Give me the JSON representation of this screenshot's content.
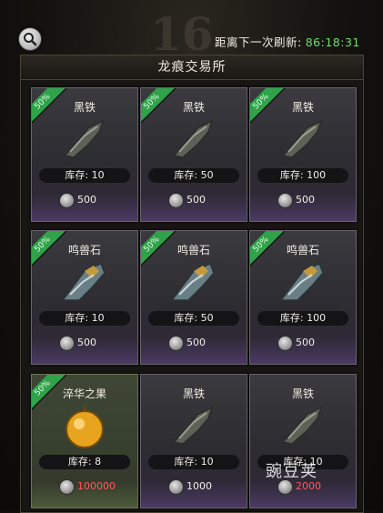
{
  "header": {
    "refresh_label": "距离下一次刷新:",
    "refresh_timer": "86:18:31"
  },
  "panel": {
    "title": "龙痕交易所"
  },
  "cards": [
    {
      "name": "黑铁",
      "discount": "50%",
      "stock": "库存: 10",
      "price": "500",
      "icon": "black-iron-icon",
      "theme": "purple",
      "price_color": "#f2efe8"
    },
    {
      "name": "黑铁",
      "discount": "50%",
      "stock": "库存: 50",
      "price": "500",
      "icon": "black-iron-icon",
      "theme": "purple",
      "price_color": "#f2efe8"
    },
    {
      "name": "黑铁",
      "discount": "50%",
      "stock": "库存: 100",
      "price": "500",
      "icon": "black-iron-icon",
      "theme": "purple",
      "price_color": "#f2efe8"
    },
    {
      "name": "鸣兽石",
      "discount": "50%",
      "stock": "库存: 10",
      "price": "500",
      "icon": "beast-stone-icon",
      "theme": "purple",
      "price_color": "#f2efe8"
    },
    {
      "name": "鸣兽石",
      "discount": "50%",
      "stock": "库存: 50",
      "price": "500",
      "icon": "beast-stone-icon",
      "theme": "purple",
      "price_color": "#f2efe8"
    },
    {
      "name": "鸣兽石",
      "discount": "50%",
      "stock": "库存: 100",
      "price": "500",
      "icon": "beast-stone-icon",
      "theme": "purple",
      "price_color": "#f2efe8"
    },
    {
      "name": "淬华之果",
      "discount": "50%",
      "stock": "库存: 8",
      "price": "100000",
      "icon": "golden-fruit-icon",
      "theme": "gold",
      "price_color": "#ff5a5a"
    },
    {
      "name": "黑铁",
      "discount": "",
      "stock": "库存: 10",
      "price": "1000",
      "icon": "black-iron-icon",
      "theme": "purple",
      "price_color": "#f2efe8"
    },
    {
      "name": "黑铁",
      "discount": "",
      "stock": "库存: 10",
      "price": "2000",
      "icon": "black-iron-icon",
      "theme": "purple",
      "price_color": "#ff5a5a"
    }
  ],
  "watermark": "豌豆荚"
}
